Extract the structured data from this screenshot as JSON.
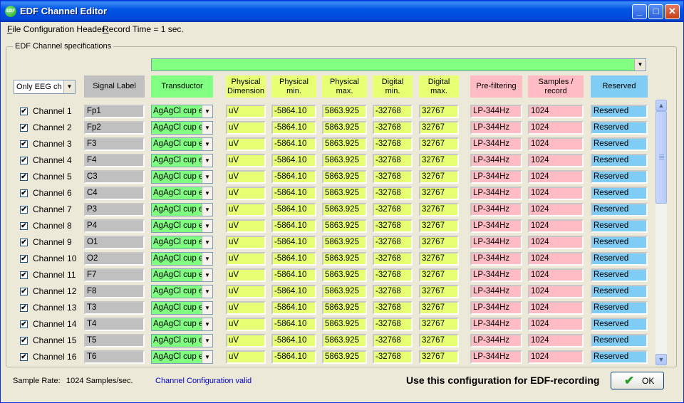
{
  "window": {
    "title": "EDF Channel Editor",
    "icon": "edf-app-icon",
    "icon_text": "EDF"
  },
  "controls": {
    "minimize": "_",
    "maximize": "□",
    "close": "✕"
  },
  "menu": {
    "file_config_first": "F",
    "file_config_rest": "ile Configuration Header",
    "record_first": "R",
    "record_rest": "ecord Time = 1 sec."
  },
  "group_label": "EDF Channel specifications",
  "filter_combo": "Only EEG ch",
  "headers": {
    "signal_label": "Signal Label",
    "transductor": "Transductor",
    "phys_dim": [
      "Physical",
      "Dimension"
    ],
    "phys_min": [
      "Physical",
      "min."
    ],
    "phys_max": [
      "Physical",
      "max."
    ],
    "dig_min": [
      "Digital",
      "min."
    ],
    "dig_max": [
      "Digital",
      "max."
    ],
    "prefilter": "Pre-filtering",
    "samples": [
      "Samples /",
      "record"
    ],
    "reserved": "Reserved"
  },
  "rows": [
    {
      "name": "Channel 1",
      "checked": true,
      "label": "Fp1",
      "transductor": "AgAgCl cup e",
      "dim": "uV",
      "pmin": "-5864.10",
      "pmax": "5863.925",
      "dmin": "-32768",
      "dmax": "32767",
      "prefilter": "LP-344Hz",
      "samples": "1024",
      "reserved": "Reserved"
    },
    {
      "name": "Channel 2",
      "checked": true,
      "label": "Fp2",
      "transductor": "AgAgCl cup e",
      "dim": "uV",
      "pmin": "-5864.10",
      "pmax": "5863.925",
      "dmin": "-32768",
      "dmax": "32767",
      "prefilter": "LP-344Hz",
      "samples": "1024",
      "reserved": "Reserved"
    },
    {
      "name": "Channel 3",
      "checked": true,
      "label": "F3",
      "transductor": "AgAgCl cup e",
      "dim": "uV",
      "pmin": "-5864.10",
      "pmax": "5863.925",
      "dmin": "-32768",
      "dmax": "32767",
      "prefilter": "LP-344Hz",
      "samples": "1024",
      "reserved": "Reserved"
    },
    {
      "name": "Channel 4",
      "checked": true,
      "label": "F4",
      "transductor": "AgAgCl cup e",
      "dim": "uV",
      "pmin": "-5864.10",
      "pmax": "5863.925",
      "dmin": "-32768",
      "dmax": "32767",
      "prefilter": "LP-344Hz",
      "samples": "1024",
      "reserved": "Reserved"
    },
    {
      "name": "Channel 5",
      "checked": true,
      "label": "C3",
      "transductor": "AgAgCl cup e",
      "dim": "uV",
      "pmin": "-5864.10",
      "pmax": "5863.925",
      "dmin": "-32768",
      "dmax": "32767",
      "prefilter": "LP-344Hz",
      "samples": "1024",
      "reserved": "Reserved"
    },
    {
      "name": "Channel 6",
      "checked": true,
      "label": "C4",
      "transductor": "AgAgCl cup e",
      "dim": "uV",
      "pmin": "-5864.10",
      "pmax": "5863.925",
      "dmin": "-32768",
      "dmax": "32767",
      "prefilter": "LP-344Hz",
      "samples": "1024",
      "reserved": "Reserved"
    },
    {
      "name": "Channel 7",
      "checked": true,
      "label": "P3",
      "transductor": "AgAgCl cup e",
      "dim": "uV",
      "pmin": "-5864.10",
      "pmax": "5863.925",
      "dmin": "-32768",
      "dmax": "32767",
      "prefilter": "LP-344Hz",
      "samples": "1024",
      "reserved": "Reserved"
    },
    {
      "name": "Channel 8",
      "checked": true,
      "label": "P4",
      "transductor": "AgAgCl cup e",
      "dim": "uV",
      "pmin": "-5864.10",
      "pmax": "5863.925",
      "dmin": "-32768",
      "dmax": "32767",
      "prefilter": "LP-344Hz",
      "samples": "1024",
      "reserved": "Reserved"
    },
    {
      "name": "Channel 9",
      "checked": true,
      "label": "O1",
      "transductor": "AgAgCl cup e",
      "dim": "uV",
      "pmin": "-5864.10",
      "pmax": "5863.925",
      "dmin": "-32768",
      "dmax": "32767",
      "prefilter": "LP-344Hz",
      "samples": "1024",
      "reserved": "Reserved"
    },
    {
      "name": "Channel 10",
      "checked": true,
      "label": "O2",
      "transductor": "AgAgCl cup e",
      "dim": "uV",
      "pmin": "-5864.10",
      "pmax": "5863.925",
      "dmin": "-32768",
      "dmax": "32767",
      "prefilter": "LP-344Hz",
      "samples": "1024",
      "reserved": "Reserved"
    },
    {
      "name": "Channel 11",
      "checked": true,
      "label": "F7",
      "transductor": "AgAgCl cup e",
      "dim": "uV",
      "pmin": "-5864.10",
      "pmax": "5863.925",
      "dmin": "-32768",
      "dmax": "32767",
      "prefilter": "LP-344Hz",
      "samples": "1024",
      "reserved": "Reserved"
    },
    {
      "name": "Channel 12",
      "checked": true,
      "label": "F8",
      "transductor": "AgAgCl cup e",
      "dim": "uV",
      "pmin": "-5864.10",
      "pmax": "5863.925",
      "dmin": "-32768",
      "dmax": "32767",
      "prefilter": "LP-344Hz",
      "samples": "1024",
      "reserved": "Reserved"
    },
    {
      "name": "Channel 13",
      "checked": true,
      "label": "T3",
      "transductor": "AgAgCl cup e",
      "dim": "uV",
      "pmin": "-5864.10",
      "pmax": "5863.925",
      "dmin": "-32768",
      "dmax": "32767",
      "prefilter": "LP-344Hz",
      "samples": "1024",
      "reserved": "Reserved"
    },
    {
      "name": "Channel 14",
      "checked": true,
      "label": "T4",
      "transductor": "AgAgCl cup e",
      "dim": "uV",
      "pmin": "-5864.10",
      "pmax": "5863.925",
      "dmin": "-32768",
      "dmax": "32767",
      "prefilter": "LP-344Hz",
      "samples": "1024",
      "reserved": "Reserved"
    },
    {
      "name": "Channel 15",
      "checked": true,
      "label": "T5",
      "transductor": "AgAgCl cup e",
      "dim": "uV",
      "pmin": "-5864.10",
      "pmax": "5863.925",
      "dmin": "-32768",
      "dmax": "32767",
      "prefilter": "LP-344Hz",
      "samples": "1024",
      "reserved": "Reserved"
    },
    {
      "name": "Channel 16",
      "checked": true,
      "label": "T6",
      "transductor": "AgAgCl cup e",
      "dim": "uV",
      "pmin": "-5864.10",
      "pmax": "5863.925",
      "dmin": "-32768",
      "dmax": "32767",
      "prefilter": "LP-344Hz",
      "samples": "1024",
      "reserved": "Reserved"
    }
  ],
  "status": {
    "sample_rate_label": "Sample Rate:",
    "sample_rate_value": "1024 Samples/sec.",
    "config_status": "Channel Configuration valid",
    "use_config": "Use this configuration for EDF-recording",
    "ok_label": "OK"
  },
  "colors": {
    "signal_label": "#C0C0C0",
    "transductor": "#80FF80",
    "physical_digital": "#E6FF73",
    "prefilter_samples": "#FFBCC4",
    "reserved": "#7FCCF4",
    "status_link": "#0000CC"
  },
  "glyphs": {
    "dropdown": "▼",
    "scroll_up": "▲",
    "scroll_down": "▼",
    "check": "✔"
  }
}
